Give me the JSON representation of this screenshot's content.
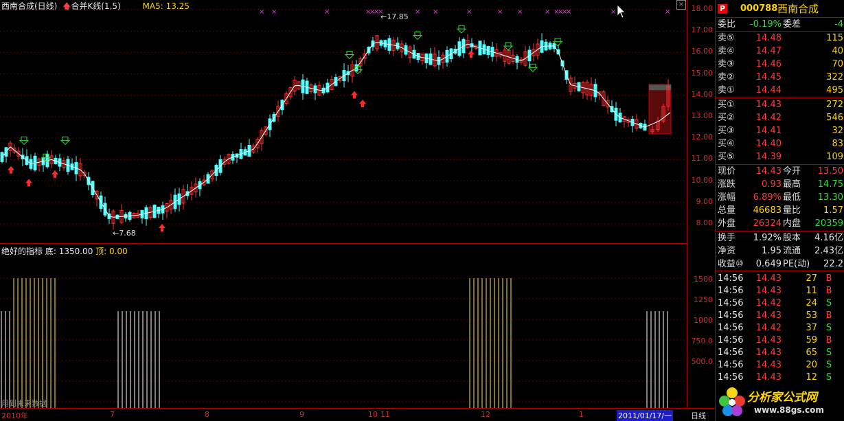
{
  "main_header": {
    "title": "西南合成(日线)",
    "indicator": "合并K线(1,5)",
    "ma": "MA5: 13.25"
  },
  "indicator_header": {
    "title": "绝好的指标",
    "bottom": "底: 1350.00",
    "top": "顶: 0.00"
  },
  "footer_note": "用到未来数据",
  "price_axis": [
    "18.00",
    "17.00",
    "16.00",
    "15.00",
    "14.00",
    "13.00",
    "12.00",
    "11.00",
    "10.00",
    "9.00",
    "8.00"
  ],
  "indicator_axis": [
    "1500",
    "1250",
    "1000",
    "750.0",
    "500.0"
  ],
  "time_axis": {
    "labels": [
      "2010年",
      "7",
      "8",
      "9",
      "10",
      "11",
      "12",
      "1"
    ],
    "current": "2011/01/17/一",
    "period": "日线"
  },
  "annotations": {
    "high": "17.85",
    "low": "7.68"
  },
  "quote": {
    "code": "000788",
    "name": "西南合成",
    "badge": "P",
    "wb_label": "委比",
    "wb_value": "-0.19%",
    "wc_label": "委差",
    "wc_value": "-4",
    "asks": [
      {
        "label": "卖⑤",
        "price": "14.48",
        "vol": "115"
      },
      {
        "label": "卖④",
        "price": "14.47",
        "vol": "40"
      },
      {
        "label": "卖③",
        "price": "14.46",
        "vol": "70"
      },
      {
        "label": "卖②",
        "price": "14.45",
        "vol": "322"
      },
      {
        "label": "卖①",
        "price": "14.44",
        "vol": "495"
      }
    ],
    "bids": [
      {
        "label": "买①",
        "price": "14.43",
        "vol": "272"
      },
      {
        "label": "买②",
        "price": "14.42",
        "vol": "546"
      },
      {
        "label": "买③",
        "price": "14.41",
        "vol": "32"
      },
      {
        "label": "买④",
        "price": "14.40",
        "vol": "83"
      },
      {
        "label": "买⑤",
        "price": "14.39",
        "vol": "109"
      }
    ],
    "stats": [
      {
        "l1": "现价",
        "v1": "14.43",
        "l2": "今开",
        "v2": "13.50"
      },
      {
        "l1": "涨跌",
        "v1": "0.93",
        "l2": "最高",
        "v2": "14.75"
      },
      {
        "l1": "涨幅",
        "v1": "6.89%",
        "l2": "最低",
        "v2": "13.30"
      },
      {
        "l1": "总量",
        "v1": "46683",
        "l2": "量比",
        "v2": "1.57"
      },
      {
        "l1": "外盘",
        "v1": "26324",
        "l2": "内盘",
        "v2": "20359"
      }
    ],
    "stats2": [
      {
        "l1": "换手",
        "v1": "1.92%",
        "l2": "股本",
        "v2": "4.16亿"
      },
      {
        "l1": "净资",
        "v1": "1.95",
        "l2": "流通",
        "v2": "2.43亿"
      },
      {
        "l1": "收益⑩",
        "v1": "0.649",
        "l2": "PE(动)",
        "v2": "22.2"
      }
    ],
    "ticks": [
      {
        "t": "14:56",
        "p": "14.43",
        "v": "27",
        "s": "B"
      },
      {
        "t": "14:56",
        "p": "14.43",
        "v": "11",
        "s": "B"
      },
      {
        "t": "14:56",
        "p": "14.42",
        "v": "24",
        "s": "S"
      },
      {
        "t": "14:56",
        "p": "14.43",
        "v": "53",
        "s": "B"
      },
      {
        "t": "14:56",
        "p": "14.42",
        "v": "37",
        "s": "S"
      },
      {
        "t": "14:56",
        "p": "14.43",
        "v": "59",
        "s": "B"
      },
      {
        "t": "14:56",
        "p": "14.43",
        "v": "65",
        "s": "S"
      },
      {
        "t": "14:56",
        "p": "14.43",
        "v": "20",
        "s": "S"
      },
      {
        "t": "14:56",
        "p": "14.43",
        "v": "12",
        "s": "S"
      }
    ],
    "watermark": {
      "title": "分析家公式网",
      "url": "www.88gs.com"
    }
  }
}
